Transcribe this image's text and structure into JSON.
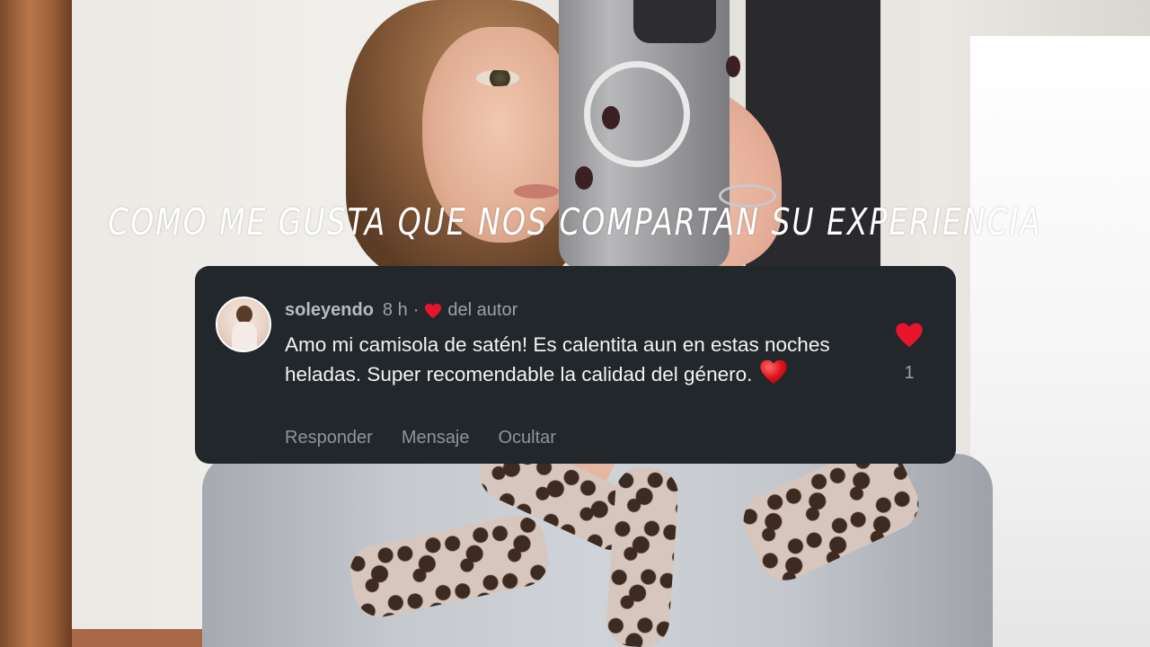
{
  "overlay": {
    "caption": "Como me gusta que nos compartan su experiencia"
  },
  "comment": {
    "username": "soleyendo",
    "time": "8 h",
    "separator": "·",
    "author_label": "del autor",
    "text": "Amo mi camisola de satén! Es calentita aun en estas noches heladas. Super recomendable la calidad del género.",
    "actions": {
      "reply": "Responder",
      "message": "Mensaje",
      "hide": "Ocultar"
    },
    "like_count": "1"
  },
  "colors": {
    "card_background": "#21272a",
    "heart_red": "#e8142c"
  },
  "icons": {
    "author_like": "heart-icon",
    "like": "heart-icon",
    "emoji": "red-heart-emoji"
  }
}
